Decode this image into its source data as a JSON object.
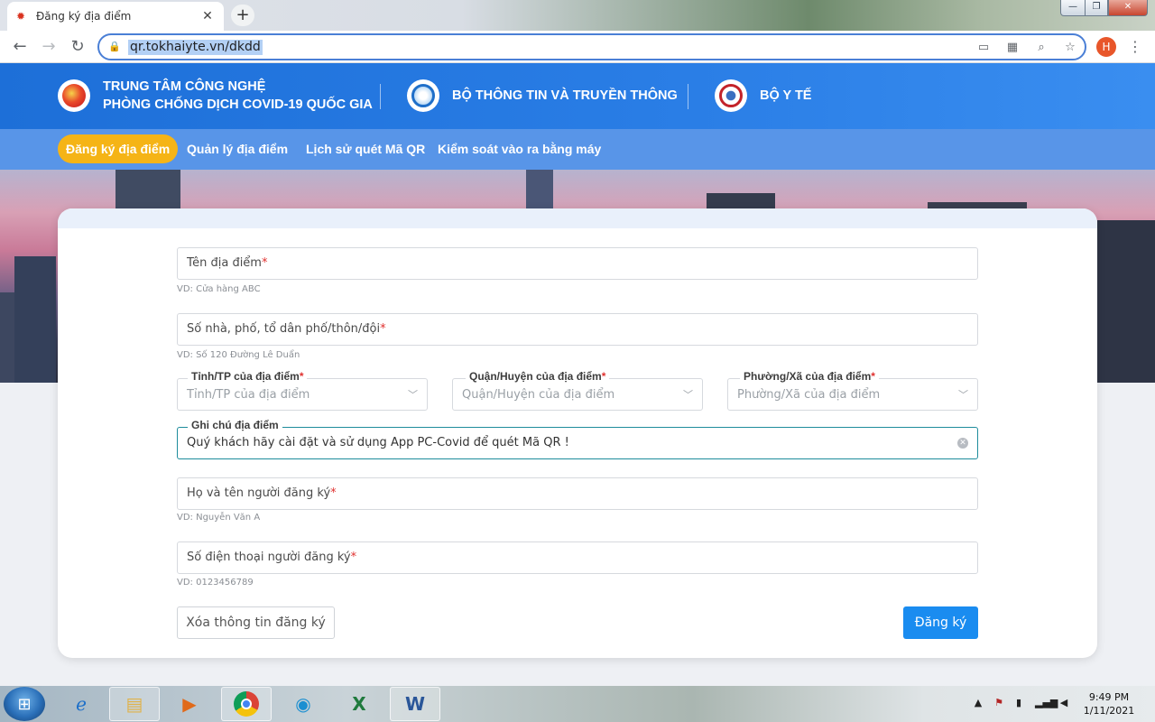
{
  "browser": {
    "tab_title": "Đăng ký địa điểm",
    "new_tab": "+",
    "url": "qr.tokhaiyte.vn/dkdd",
    "profile_initial": "H",
    "window_min": "—",
    "window_max": "❐",
    "window_close": "✕"
  },
  "header": {
    "org1_line1": "TRUNG TÂM CÔNG NGHỆ",
    "org1_line2": "PHÒNG CHỐNG DỊCH COVID-19 QUỐC GIA",
    "org2": "BỘ THÔNG TIN VÀ TRUYỀN THÔNG",
    "org3": "BỘ Y TẾ"
  },
  "nav": {
    "items": [
      {
        "label": "Đăng ký địa điểm",
        "active": true
      },
      {
        "label": "Quản lý địa điểm",
        "active": false
      },
      {
        "label": "Lịch sử quét Mã QR",
        "active": false
      },
      {
        "label": "Kiểm soát vào ra bằng máy",
        "active": false
      }
    ]
  },
  "form": {
    "location_name": {
      "label": "Tên địa điểm",
      "required_mark": "*",
      "hint": "VD: Cửa hàng ABC"
    },
    "address": {
      "label": "Số nhà, phố, tổ dân phố/thôn/đội",
      "required_mark": "*",
      "hint": "VD: Số 120 Đường Lê Duẩn"
    },
    "province": {
      "label": "Tỉnh/TP của địa điểm",
      "required_mark": "*",
      "placeholder": "Tỉnh/TP của địa điểm"
    },
    "district": {
      "label": "Quận/Huyện của địa điểm",
      "required_mark": "*",
      "placeholder": "Quận/Huyện của địa điểm"
    },
    "ward": {
      "label": "Phường/Xã của địa điểm",
      "required_mark": "*",
      "placeholder": "Phường/Xã của địa điểm"
    },
    "note": {
      "label": "Ghi chú địa điểm",
      "value": "Quý khách hãy cài đặt và sử dụng App PC-Covid để quét Mã QR !"
    },
    "registrant_name": {
      "label": "Họ và tên người đăng ký",
      "required_mark": "*",
      "hint": "VD: Nguyễn Văn A"
    },
    "registrant_phone": {
      "label": "Số điện thoại người đăng ký",
      "required_mark": "*",
      "hint": "VD: 0123456789"
    },
    "clear_button": "Xóa thông tin đăng ký",
    "submit_button": "Đăng ký"
  },
  "taskbar": {
    "time": "9:49 PM",
    "date": "1/11/2021"
  },
  "colors": {
    "header_blue": "#2a7ee6",
    "active_nav": "#f5b416",
    "submit_blue": "#1a8cf0",
    "required_red": "#e0312f"
  }
}
